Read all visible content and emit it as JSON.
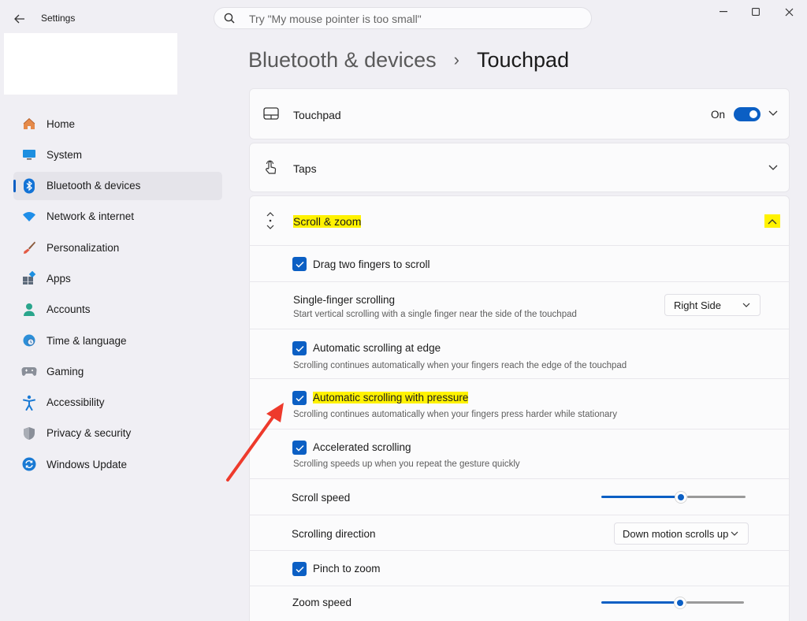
{
  "window": {
    "title": "Settings",
    "controls": [
      "minimize-icon",
      "maximize-icon",
      "close-icon"
    ]
  },
  "search": {
    "placeholder": "Try \"My mouse pointer is too small\"",
    "value": ""
  },
  "sidebar": {
    "items": [
      {
        "label": "Home",
        "icon": "home-icon"
      },
      {
        "label": "System",
        "icon": "system-icon"
      },
      {
        "label": "Bluetooth & devices",
        "icon": "bluetooth-icon",
        "selected": true
      },
      {
        "label": "Network & internet",
        "icon": "wifi-icon"
      },
      {
        "label": "Personalization",
        "icon": "brush-icon"
      },
      {
        "label": "Apps",
        "icon": "apps-icon"
      },
      {
        "label": "Accounts",
        "icon": "person-icon"
      },
      {
        "label": "Time & language",
        "icon": "globe-clock-icon"
      },
      {
        "label": "Gaming",
        "icon": "gamepad-icon"
      },
      {
        "label": "Accessibility",
        "icon": "accessibility-icon"
      },
      {
        "label": "Privacy & security",
        "icon": "shield-icon"
      },
      {
        "label": "Windows Update",
        "icon": "update-icon"
      }
    ]
  },
  "breadcrumb": {
    "parent": "Bluetooth & devices",
    "separator": "›",
    "current": "Touchpad"
  },
  "touchpad_card": {
    "label": "Touchpad",
    "toggle_state": "On",
    "toggle_on": true
  },
  "taps_card": {
    "label": "Taps"
  },
  "scroll_zoom": {
    "label": "Scroll & zoom",
    "drag_two_fingers": {
      "label": "Drag two fingers to scroll",
      "checked": true
    },
    "single_finger": {
      "label": "Single-finger scrolling",
      "sub": "Start vertical scrolling with a single finger near the side of the touchpad",
      "value": "Right Side"
    },
    "auto_edge": {
      "label": "Automatic scrolling at edge",
      "sub": "Scrolling continues automatically when your fingers reach the edge of the touchpad",
      "checked": true
    },
    "auto_pressure": {
      "label": "Automatic scrolling with pressure",
      "sub": "Scrolling continues automatically when your fingers press harder while stationary",
      "checked": true
    },
    "accelerated": {
      "label": "Accelerated scrolling",
      "sub": "Scrolling speeds up when you repeat the gesture quickly",
      "checked": true
    },
    "scroll_speed": {
      "label": "Scroll speed",
      "level": 0.55
    },
    "scroll_direction": {
      "label": "Scrolling direction",
      "value": "Down motion scrolls up"
    },
    "pinch_zoom": {
      "label": "Pinch to zoom",
      "checked": true
    },
    "zoom_speed": {
      "label": "Zoom speed",
      "level": 0.55
    }
  },
  "colors": {
    "accent": "#0b5fc4",
    "highlight": "#fff200",
    "annotation_arrow": "#ee3a2c"
  }
}
